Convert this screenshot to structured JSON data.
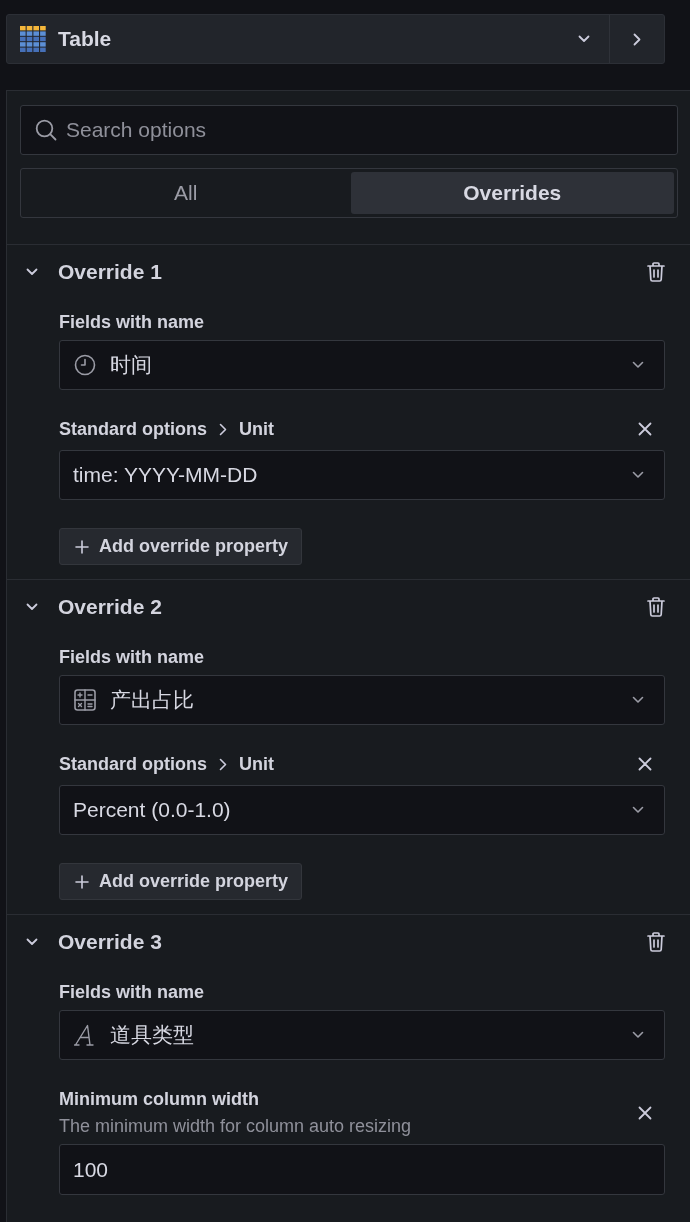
{
  "visualization_picker": {
    "label": "Table"
  },
  "search": {
    "placeholder": "Search options"
  },
  "tabs": [
    {
      "label": "All",
      "selected": false
    },
    {
      "label": "Overrides",
      "selected": true
    }
  ],
  "overrides": [
    {
      "title": "Override 1",
      "expanded": true,
      "matcher": {
        "label": "Fields with name",
        "kind": "time",
        "value": "时间"
      },
      "properties": [
        {
          "kind": "select",
          "path": [
            "Standard options",
            "Unit"
          ],
          "value": "time: YYYY-MM-DD"
        }
      ],
      "add_button": "Add override property"
    },
    {
      "title": "Override 2",
      "expanded": true,
      "matcher": {
        "label": "Fields with name",
        "kind": "number",
        "value": "产出占比"
      },
      "properties": [
        {
          "kind": "select",
          "path": [
            "Standard options",
            "Unit"
          ],
          "value": "Percent (0.0-1.0)"
        }
      ],
      "add_button": "Add override property"
    },
    {
      "title": "Override 3",
      "expanded": true,
      "matcher": {
        "label": "Fields with name",
        "kind": "string",
        "value": "道具类型"
      },
      "properties": [
        {
          "kind": "input",
          "path": [
            "Minimum column width"
          ],
          "description": "The minimum width for column auto resizing",
          "value": "100"
        }
      ]
    }
  ]
}
